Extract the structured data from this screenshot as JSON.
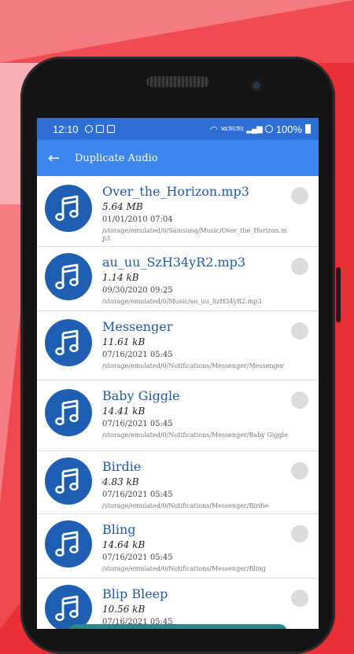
{
  "status_bar": {
    "time": "12:10",
    "network": "VoLTE LTE1",
    "battery": "100%"
  },
  "app_bar": {
    "back_icon": "arrow-left-icon",
    "title": "Duplicate Audio"
  },
  "items": [
    {
      "name": "Over_the_Horizon.mp3",
      "size": "5.64 MB",
      "date": "01/01/2010 07:04",
      "path": "/storage/emulated/0/Samsung/Music/Over_the_Horizon.mp3"
    },
    {
      "name": "au_uu_SzH34yR2.mp3",
      "size": "1.14 kB",
      "date": "09/30/2020 09:25",
      "path": "/storage/emulated/0/Music/au_uu_SzH34yR2.mp3"
    },
    {
      "name": "Messenger",
      "size": "11.61 kB",
      "date": "07/16/2021 05:45",
      "path": "/storage/emulated/0/Notifications/Messenger/Messenger"
    },
    {
      "name": "Baby Giggle",
      "size": "14.41 kB",
      "date": "07/16/2021 05:45",
      "path": "/storage/emulated/0/Notifications/Messenger/Baby Giggle"
    },
    {
      "name": "Birdie",
      "size": "4.83 kB",
      "date": "07/16/2021 05:45",
      "path": "/storage/emulated/0/Notifications/Messenger/Birdie"
    },
    {
      "name": "Bling",
      "size": "14.64 kB",
      "date": "07/16/2021 05:45",
      "path": "/storage/emulated/0/Notifications/Messenger/Bling"
    },
    {
      "name": "Blip Bleep",
      "size": "10.56 kB",
      "date": "07/16/2021 05:45",
      "path": ""
    }
  ],
  "colors": {
    "primary": "#3d86ef",
    "status": "#2e6fd6",
    "icon_circle": "#1f5fb3",
    "title_text": "#2358a8",
    "background": "#ea2f37"
  }
}
